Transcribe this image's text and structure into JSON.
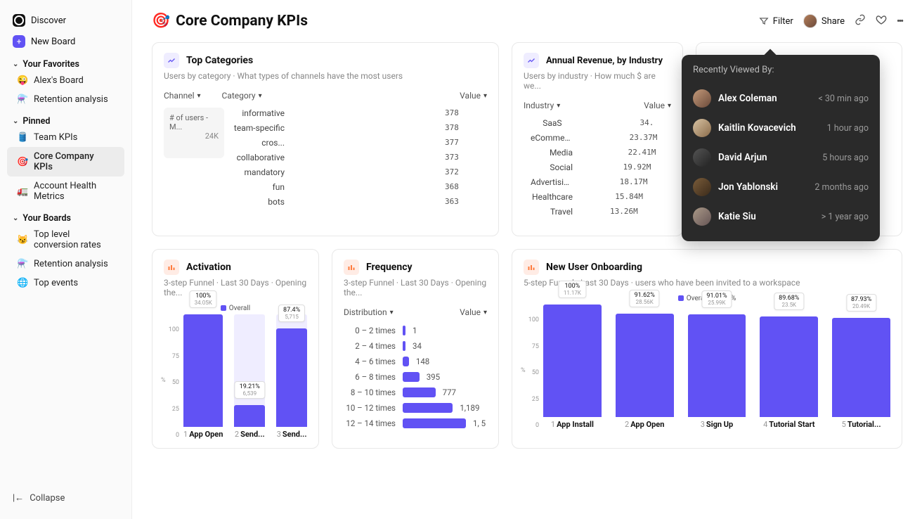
{
  "sidebar": {
    "discover": "Discover",
    "new_board": "New Board",
    "favorites_hdr": "Your Favorites",
    "favorites": [
      {
        "emoji": "😜",
        "label": "Alex's Board"
      },
      {
        "emoji": "⚗️",
        "label": "Retention analysis"
      }
    ],
    "pinned_hdr": "Pinned",
    "pinned": [
      {
        "emoji": "🛢️",
        "label": "Team KPIs"
      },
      {
        "emoji": "🎯",
        "label": "Core Company KPIs"
      },
      {
        "emoji": "🚛",
        "label": "Account Health Metrics"
      }
    ],
    "boards_hdr": "Your Boards",
    "boards": [
      {
        "emoji": "😼",
        "label": "Top level conversion rates"
      },
      {
        "emoji": "⚗️",
        "label": "Retention analysis"
      },
      {
        "emoji": "🌐",
        "label": "Top events"
      }
    ],
    "collapse": "Collapse"
  },
  "header": {
    "title_emoji": "🎯",
    "title": "Core Company KPIs",
    "filter": "Filter",
    "share": "Share"
  },
  "top_categories": {
    "title": "Top Categories",
    "sub": "Users by category · What types of channels have the most users",
    "filters": {
      "a": "Channel",
      "b": "Category",
      "c": "Value"
    },
    "chip_label": "# of users - M...",
    "chip_value": "24K"
  },
  "annual_revenue": {
    "title": "Annual Revenue, by Industry",
    "sub": "Users by industry · How much $ are we...",
    "filters": {
      "a": "Industry",
      "b": "Value"
    }
  },
  "activation": {
    "title": "Activation",
    "sub": "3-step Funnel · Last 30 Days · Opening the...",
    "legend": "Overall",
    "ylabel": "%"
  },
  "frequency": {
    "title": "Frequency",
    "sub": "3-step Funnel · Last 30 Days · Opening the...",
    "filters": {
      "a": "Distribution",
      "b": "Value"
    }
  },
  "onboarding": {
    "title": "New User Onboarding",
    "sub": "5-step Funnel · Last 30 Days · users who have been invited to a workspace",
    "legend": "Overall - 65.75%",
    "ylabel": "%"
  },
  "popover": {
    "hdr": "Recently Viewed By:",
    "rows": [
      {
        "name": "Alex Coleman",
        "time": "< 30 min ago",
        "grad": "linear-gradient(135deg,#c49a7a,#6b4a3a)"
      },
      {
        "name": "Kaitlin Kovacevich",
        "time": "1 hour ago",
        "grad": "linear-gradient(135deg,#d8c3a3,#8a6b4a)"
      },
      {
        "name": "David Arjun",
        "time": "5 hours ago",
        "grad": "linear-gradient(135deg,#555,#222)"
      },
      {
        "name": "Jon Yablonski",
        "time": "2 months ago",
        "grad": "linear-gradient(135deg,#7a5c3a,#3a2a1a)"
      },
      {
        "name": "Katie Siu",
        "time": "> 1 year ago",
        "grad": "linear-gradient(135deg,#a98,#655)"
      }
    ]
  },
  "chart_data": [
    {
      "id": "top_categories",
      "type": "bar",
      "orientation": "horizontal",
      "categories": [
        "informative",
        "team-specific",
        "cros...",
        "collaborative",
        "mandatory",
        "fun",
        "bots"
      ],
      "values": [
        378,
        378,
        377,
        373,
        372,
        368,
        363
      ],
      "colors": [
        "#6152f4",
        "#ff7a5a",
        "#49c7b8",
        "#f2b93b",
        "#b94a66",
        "#3aa8e8",
        "#f2a33b"
      ],
      "xlim": [
        0,
        378
      ]
    },
    {
      "id": "annual_revenue",
      "type": "bar",
      "orientation": "horizontal",
      "categories": [
        "SaaS",
        "eCommerce",
        "Media",
        "Social",
        "Advertising",
        "Healthcare",
        "Travel"
      ],
      "value_labels": [
        "34.",
        "23.37M",
        "22.41M",
        "19.92M",
        "18.17M",
        "15.84M",
        "13.26M"
      ],
      "values": [
        34.0,
        23.37,
        22.41,
        19.92,
        18.17,
        15.84,
        13.26
      ],
      "colors": [
        "#6152f4",
        "#ff7a5a",
        "#49c7b8",
        "#f2b93b",
        "#b94a66",
        "#3aa8e8",
        "#f2a33b"
      ],
      "xlim": [
        0,
        34.0
      ]
    },
    {
      "id": "activation",
      "type": "bar",
      "categories": [
        "App Open",
        "Send...",
        "Send..."
      ],
      "pct": [
        100,
        19.21,
        87.4
      ],
      "counts": [
        "34.05K",
        "6,539",
        "5,715"
      ],
      "ylim": [
        0,
        100
      ],
      "yticks": [
        "100",
        "75",
        "50",
        "25",
        "0"
      ]
    },
    {
      "id": "frequency",
      "type": "bar",
      "orientation": "horizontal",
      "categories": [
        "0 – 2 times",
        "2 – 4 times",
        "4 – 6 times",
        "6 – 8 times",
        "8 – 10 times",
        "10 – 12 times",
        "12 – 14 times"
      ],
      "values": [
        1,
        34,
        148,
        395,
        777,
        1189,
        1500
      ],
      "value_labels": [
        "1",
        "34",
        "148",
        "395",
        "777",
        "1,189",
        "1, 5"
      ],
      "xlim": [
        0,
        1500
      ]
    },
    {
      "id": "onboarding",
      "type": "bar",
      "categories": [
        "App Install",
        "App Open",
        "Sign Up",
        "Tutorial Start",
        "Tutorial..."
      ],
      "pct": [
        100,
        91.62,
        91.01,
        89.68,
        87.93
      ],
      "counts": [
        "11.17K",
        "28.56K",
        "25.99K",
        "23.5K",
        "20.49K"
      ],
      "ylim": [
        0,
        100
      ],
      "yticks": [
        "100",
        "75",
        "50",
        "25",
        "0"
      ]
    }
  ]
}
